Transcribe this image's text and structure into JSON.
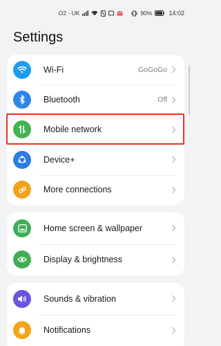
{
  "status_bar": {
    "carrier": "O2 - UK",
    "battery_percent": "90%",
    "time": "14:02"
  },
  "page": {
    "title": "Settings"
  },
  "groups": [
    {
      "items": [
        {
          "label": "Wi-Fi",
          "value": "GoGoGo",
          "icon": "wifi-icon",
          "color": "#1e9bf0"
        },
        {
          "label": "Bluetooth",
          "value": "Off",
          "icon": "bluetooth-icon",
          "color": "#2f86e8"
        },
        {
          "label": "Mobile network",
          "value": "",
          "icon": "mobile-data-icon",
          "color": "#43b354"
        },
        {
          "label": "Device+",
          "value": "",
          "icon": "device-plus-icon",
          "color": "#2b7de9"
        },
        {
          "label": "More connections",
          "value": "",
          "icon": "link-icon",
          "color": "#f3a11b"
        }
      ]
    },
    {
      "items": [
        {
          "label": "Home screen & wallpaper",
          "value": "",
          "icon": "wallpaper-icon",
          "color": "#3fae55"
        },
        {
          "label": "Display & brightness",
          "value": "",
          "icon": "eye-icon",
          "color": "#3fae55"
        }
      ]
    },
    {
      "items": [
        {
          "label": "Sounds & vibration",
          "value": "",
          "icon": "sound-icon",
          "color": "#6c53e0"
        },
        {
          "label": "Notifications",
          "value": "",
          "icon": "bell-icon",
          "color": "#f5a416"
        }
      ]
    }
  ],
  "highlight_color": "#e8321e"
}
